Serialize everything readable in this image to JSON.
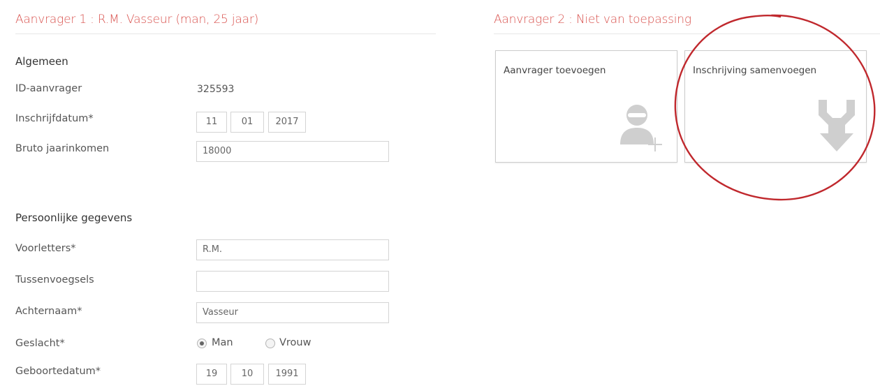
{
  "applicant1": {
    "heading": "Aanvrager 1 : R.M. Vasseur (man, 25 jaar)",
    "general": {
      "section_title": "Algemeen",
      "id_label": "ID-aanvrager",
      "id_value": "325593",
      "registration_label": "Inschrijfdatum*",
      "registration_day": "11",
      "registration_month": "01",
      "registration_year": "2017",
      "income_label": "Bruto jaarinkomen",
      "income_value": "18000"
    },
    "personal": {
      "section_title": "Persoonlijke gegevens",
      "initials_label": "Voorletters*",
      "initials_value": "R.M.",
      "prefix_label": "Tussenvoegsels",
      "prefix_value": "",
      "surname_label": "Achternaam*",
      "surname_value": "Vasseur",
      "gender_label": "Geslacht*",
      "gender_options": [
        "Man",
        "Vrouw"
      ],
      "gender_selected": "Man",
      "birthdate_label": "Geboortedatum*",
      "birth_day": "19",
      "birth_month": "10",
      "birth_year": "1991"
    }
  },
  "applicant2": {
    "heading": "Aanvrager 2 : Niet van toepassing",
    "cards": [
      {
        "title": "Aanvrager toevoegen",
        "icon": "add-user-icon"
      },
      {
        "title": "Inschrijving samenvoegen",
        "icon": "merge-icon"
      }
    ]
  },
  "colors": {
    "heading": "#d9534f",
    "annotation_circle": "#c0282d",
    "icon_gray": "#cfcfcf"
  }
}
